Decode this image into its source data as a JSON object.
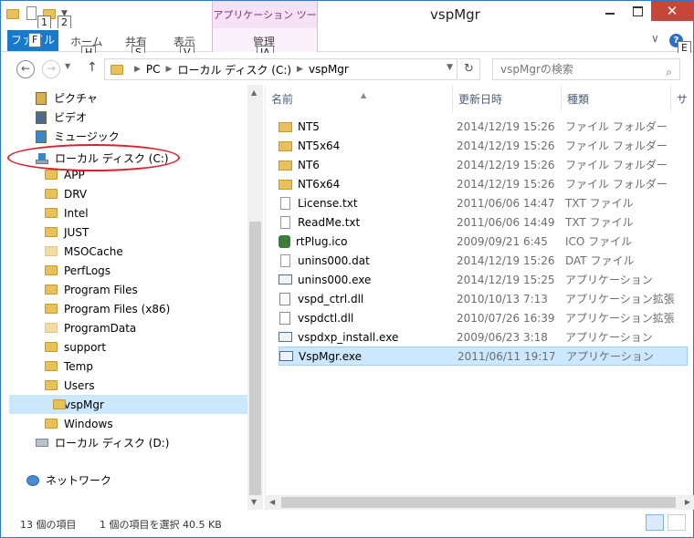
{
  "window": {
    "title": "vspMgr",
    "close_glyph": "✕"
  },
  "qat_keytips": [
    "1",
    "2"
  ],
  "ribbon": {
    "context_group": "アプリケーション ツール",
    "tabs": [
      {
        "label": "ファイル",
        "keytip": "F"
      },
      {
        "label": "ホーム",
        "keytip": "H"
      },
      {
        "label": "共有",
        "keytip": "S"
      },
      {
        "label": "表示",
        "keytip": "V"
      },
      {
        "label": "管理",
        "keytip": "JA"
      }
    ],
    "help_keytip": "E",
    "help_glyph": "?",
    "chevron_glyph": "∨"
  },
  "address": {
    "crumbs": [
      "PC",
      "ローカル ディスク (C:)",
      "vspMgr"
    ],
    "search_placeholder": "vspMgrの検索"
  },
  "nav": {
    "items": [
      {
        "label": "ピクチャ",
        "icon": "pictures-library-icon",
        "indent": 1
      },
      {
        "label": "ビデオ",
        "icon": "videos-library-icon",
        "indent": 1
      },
      {
        "label": "ミュージック",
        "icon": "music-library-icon",
        "indent": 1
      },
      {
        "label": "ローカル ディスク (C:)",
        "icon": "windows-drive-icon",
        "indent": 1
      },
      {
        "label": "APP",
        "icon": "folder-icon",
        "indent": 2
      },
      {
        "label": "DRV",
        "icon": "folder-icon",
        "indent": 2
      },
      {
        "label": "Intel",
        "icon": "folder-icon",
        "indent": 2
      },
      {
        "label": "JUST",
        "icon": "folder-icon",
        "indent": 2
      },
      {
        "label": "MSOCache",
        "icon": "folder-icon",
        "indent": 2
      },
      {
        "label": "PerfLogs",
        "icon": "folder-icon",
        "indent": 2
      },
      {
        "label": "Program Files",
        "icon": "folder-icon",
        "indent": 2
      },
      {
        "label": "Program Files (x86)",
        "icon": "folder-icon",
        "indent": 2
      },
      {
        "label": "ProgramData",
        "icon": "folder-icon",
        "indent": 2
      },
      {
        "label": "support",
        "icon": "folder-icon",
        "indent": 2
      },
      {
        "label": "Temp",
        "icon": "folder-icon",
        "indent": 2
      },
      {
        "label": "Users",
        "icon": "folder-icon",
        "indent": 2
      },
      {
        "label": "vspMgr",
        "icon": "folder-icon",
        "indent": 2,
        "selected": true
      },
      {
        "label": "Windows",
        "icon": "folder-icon",
        "indent": 2
      },
      {
        "label": "ローカル ディスク (D:)",
        "icon": "drive-icon",
        "indent": 1
      },
      {
        "label": "ネットワーク",
        "icon": "network-icon",
        "indent": 0
      }
    ]
  },
  "columns": {
    "name": "名前",
    "date": "更新日時",
    "type": "種類",
    "size": "サイ"
  },
  "files": [
    {
      "name": "NT5",
      "date": "2014/12/19 15:26",
      "type": "ファイル フォルダー",
      "icon": "folder"
    },
    {
      "name": "NT5x64",
      "date": "2014/12/19 15:26",
      "type": "ファイル フォルダー",
      "icon": "folder"
    },
    {
      "name": "NT6",
      "date": "2014/12/19 15:26",
      "type": "ファイル フォルダー",
      "icon": "folder"
    },
    {
      "name": "NT6x64",
      "date": "2014/12/19 15:26",
      "type": "ファイル フォルダー",
      "icon": "folder"
    },
    {
      "name": "License.txt",
      "date": "2011/06/06 14:47",
      "type": "TXT ファイル",
      "icon": "txt"
    },
    {
      "name": "ReadMe.txt",
      "date": "2011/06/06 14:49",
      "type": "TXT ファイル",
      "icon": "txt"
    },
    {
      "name": "rtPlug.ico",
      "date": "2009/09/21 6:45",
      "type": "ICO ファイル",
      "icon": "ico"
    },
    {
      "name": "unins000.dat",
      "date": "2014/12/19 15:26",
      "type": "DAT ファイル",
      "icon": "dat"
    },
    {
      "name": "unins000.exe",
      "date": "2014/12/19 15:25",
      "type": "アプリケーション",
      "icon": "exe"
    },
    {
      "name": "vspd_ctrl.dll",
      "date": "2010/10/13 7:13",
      "type": "アプリケーション拡張",
      "icon": "dll"
    },
    {
      "name": "vspdctl.dll",
      "date": "2010/07/26 16:39",
      "type": "アプリケーション拡張",
      "icon": "dll"
    },
    {
      "name": "vspdxp_install.exe",
      "date": "2009/06/23 3:18",
      "type": "アプリケーション",
      "icon": "exe"
    },
    {
      "name": "VspMgr.exe",
      "date": "2011/06/11 19:17",
      "type": "アプリケーション",
      "icon": "exe",
      "selected": true
    }
  ],
  "status": {
    "count": "13 個の項目",
    "selected": "1 個の項目を選択  40.5 KB"
  },
  "colors": {
    "accent": "#1979ca",
    "selection": "#cce8ff",
    "annotation": "#d4232e"
  }
}
